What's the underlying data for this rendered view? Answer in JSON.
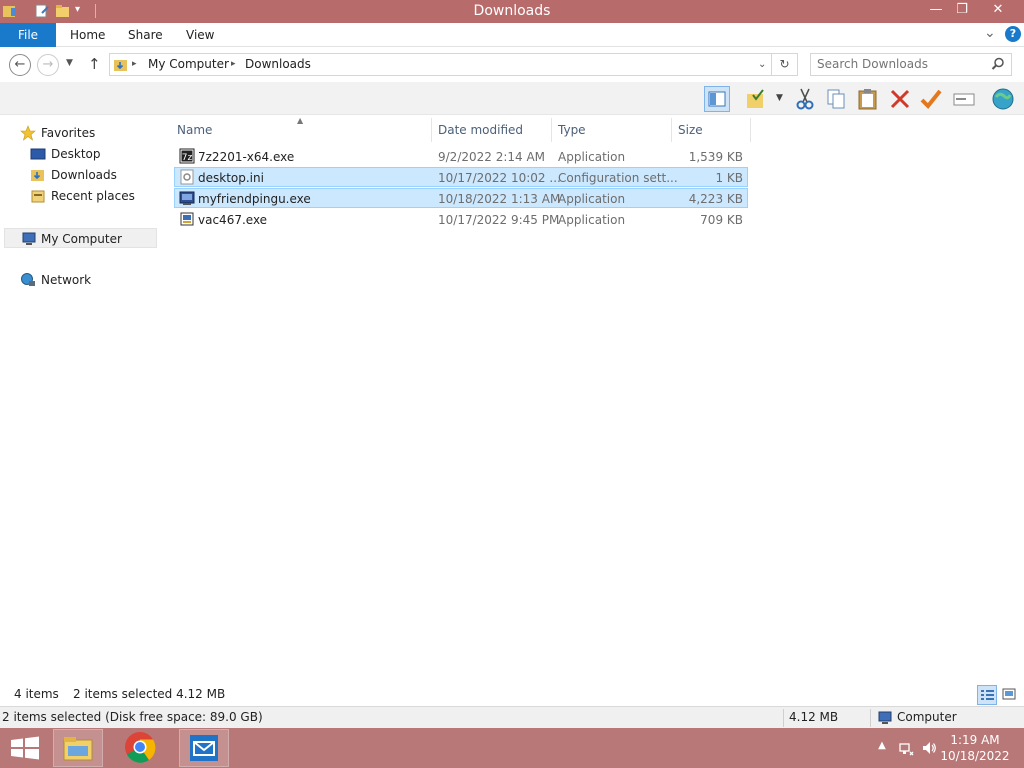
{
  "window": {
    "title": "Downloads",
    "controls": {
      "minimize": "—",
      "maximize": "❐",
      "close": "✕"
    }
  },
  "ribbon": {
    "tabs": [
      "File",
      "Home",
      "Share",
      "View"
    ],
    "expand": "⌄",
    "help": "?"
  },
  "address": {
    "crumbs": [
      "My Computer",
      "Downloads"
    ],
    "search_placeholder": "Search Downloads"
  },
  "nav_pane": {
    "favorites": "Favorites",
    "desktop": "Desktop",
    "downloads": "Downloads",
    "recent": "Recent places",
    "computer": "My Computer",
    "network": "Network"
  },
  "columns": [
    "Name",
    "Date modified",
    "Type",
    "Size"
  ],
  "files": [
    {
      "name": "7z2201-x64.exe",
      "date": "9/2/2022 2:14 AM",
      "type": "Application",
      "size": "1,539 KB",
      "selected": false
    },
    {
      "name": "desktop.ini",
      "date": "10/17/2022 10:02 ...",
      "type": "Configuration sett...",
      "size": "1 KB",
      "selected": true
    },
    {
      "name": "myfriendpingu.exe",
      "date": "10/18/2022 1:13 AM",
      "type": "Application",
      "size": "4,223 KB",
      "selected": true
    },
    {
      "name": "vac467.exe",
      "date": "10/17/2022 9:45 PM",
      "type": "Application",
      "size": "709 KB",
      "selected": false
    }
  ],
  "status": {
    "count": "4 items",
    "selected": "2 items selected  4.12 MB"
  },
  "details": {
    "left": "2 items selected (Disk free space: 89.0 GB)",
    "size": "4.12 MB",
    "location": "Computer"
  },
  "taskbar": {
    "time": "1:19 AM",
    "date": "10/18/2022"
  },
  "colors": {
    "titlebar": "#b86b6b",
    "file_tab": "#1979ca",
    "selection": "#cce8ff",
    "taskbar": "#b97878"
  }
}
